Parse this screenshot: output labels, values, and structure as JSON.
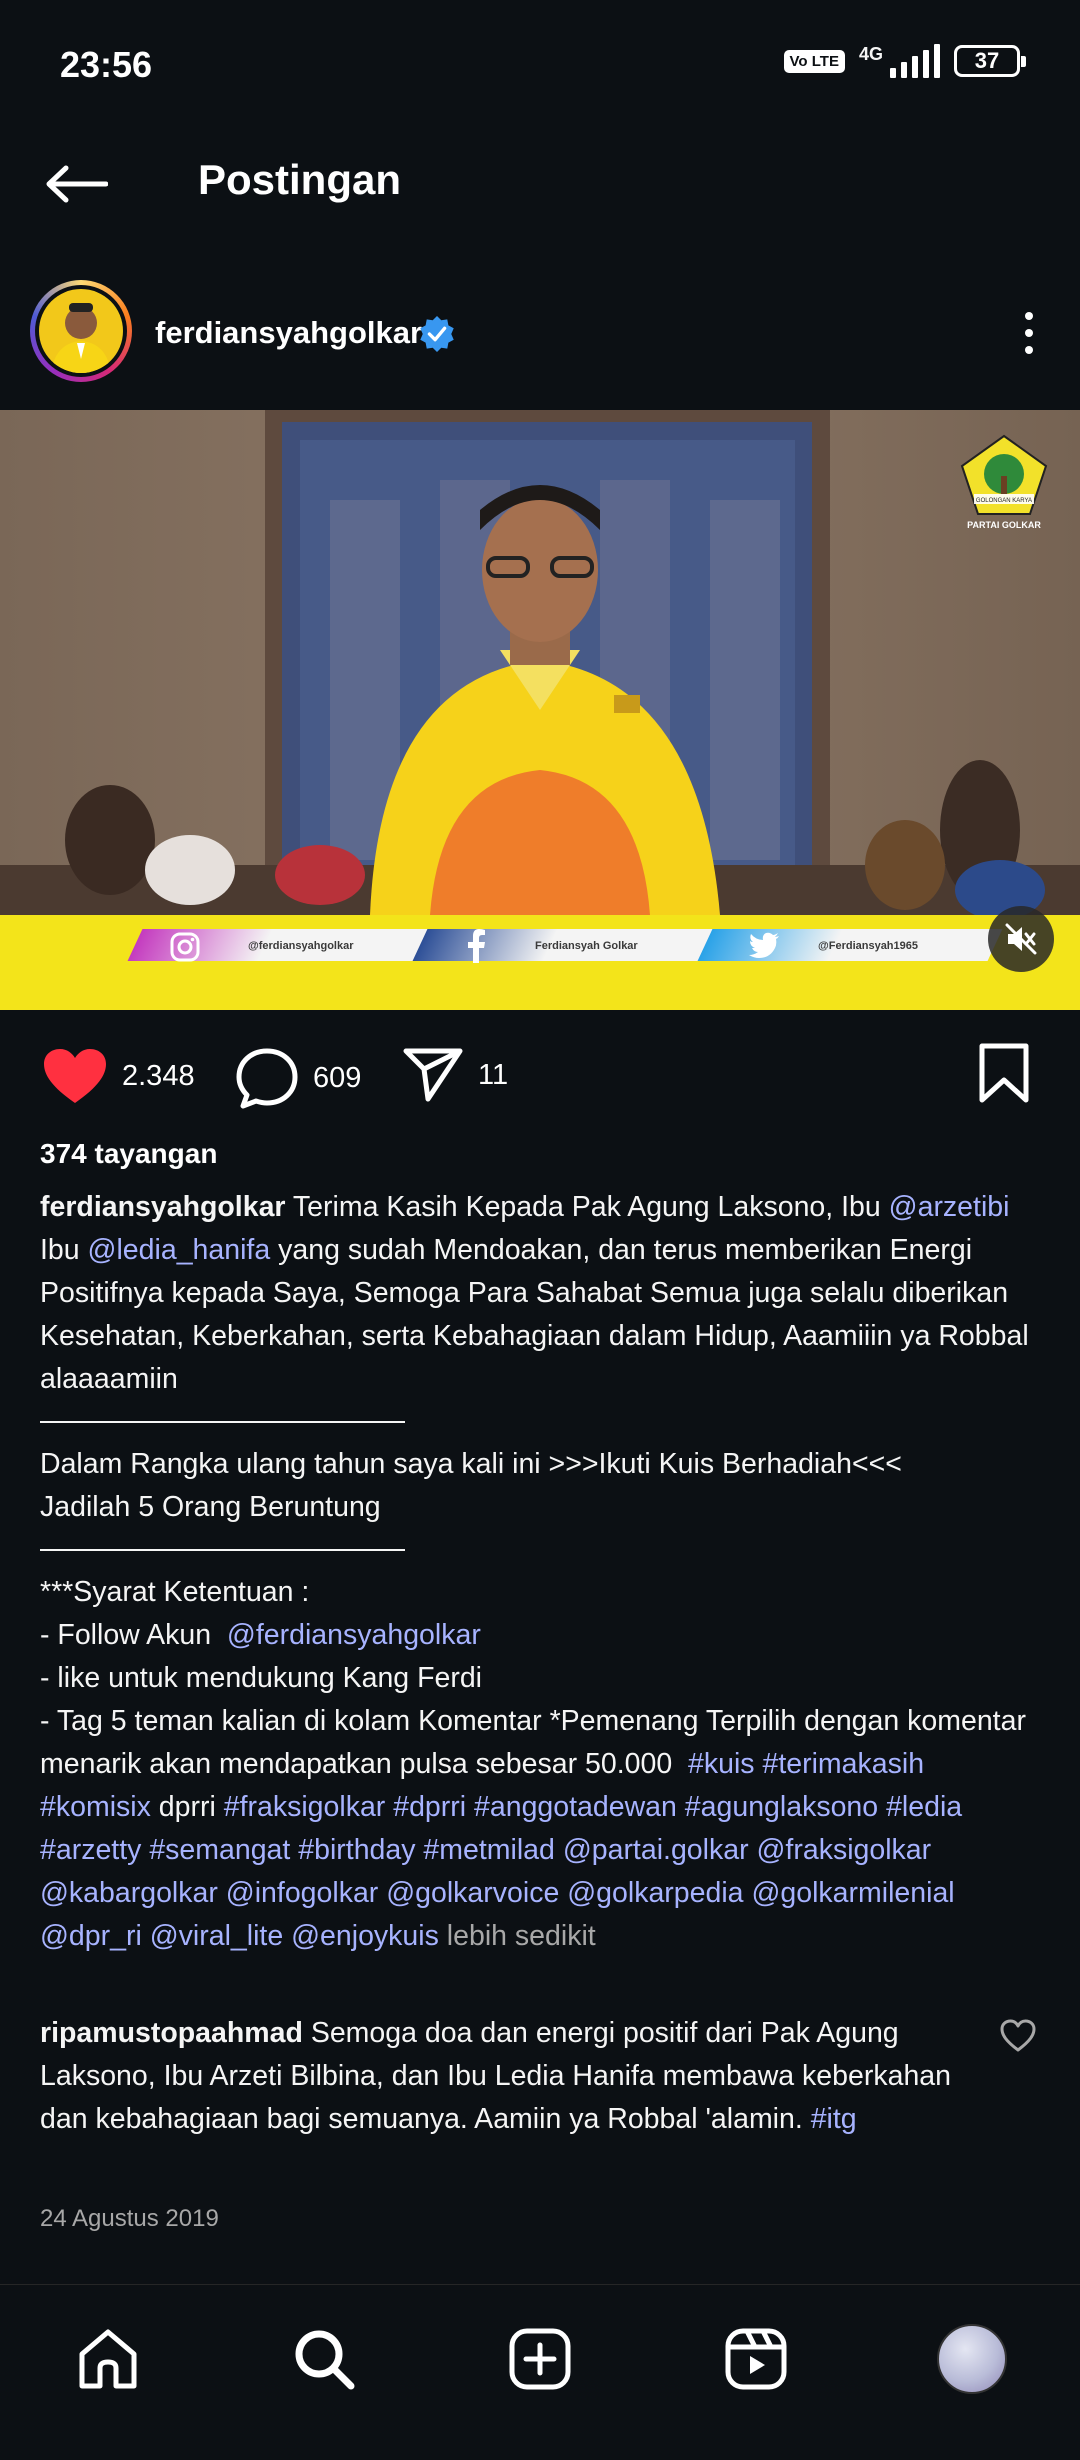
{
  "status_bar": {
    "time": "23:56",
    "volte": "Vo LTE",
    "network": "4G",
    "battery": "37"
  },
  "header": {
    "title": "Postingan"
  },
  "post": {
    "username": "ferdiansyahgolkar",
    "media": {
      "logo_text_top": "GOLONGAN KARYA",
      "logo_text_bottom": "PARTAI GOLKAR",
      "banner_instagram": "@ferdiansyahgolkar",
      "banner_facebook": "Ferdiansyah Golkar",
      "banner_twitter": "@Ferdiansyah1965"
    },
    "likes": "2.348",
    "comments": "609",
    "shares": "11",
    "views": "374 tayangan",
    "caption": {
      "author": "ferdiansyahgolkar",
      "p1_a": "Terima Kasih Kepada Pak Agung Laksono, Ibu",
      "m_arzetibi": "@arzetibi",
      "p1_b": "Ibu",
      "m_ledia": "@ledia_hanifa",
      "p1_c": "yang sudah Mendoakan, dan terus memberikan Energi Positifnya kepada Saya, Semoga Para Sahabat Semua juga selalu diberikan Kesehatan, Keberkahan, serta Kebahagiaan dalam Hidup, Aaamiiin ya Robbal alaaaamiin",
      "p2_line1": "Dalam Rangka ulang tahun saya kali ini >>>Ikuti Kuis Berhadiah<<<",
      "p2_line2": "Jadilah 5 Orang Beruntung",
      "p3_line1": "***Syarat Ketentuan :",
      "p3_follow": "- Follow Akun",
      "m_self": "@ferdiansyahgolkar",
      "p3_like": "- like untuk mendukung Kang Ferdi",
      "p3_tag": "- Tag 5 teman kalian di  kolam Komentar *Pemenang Terpilih dengan komentar menarik akan mendapatkan pulsa sebesar 50.000",
      "h_kuis": "#kuis",
      "h_terimakasih": "#terimakasih",
      "h_komisix": "#komisix",
      "w_dprri": "dprri",
      "h_fraksigolkar": "#fraksigolkar",
      "h_dprri": "#dprri",
      "h_anggotadewan": "#anggotadewan",
      "h_agunglaksono": "#agunglaksono",
      "h_ledia": "#ledia",
      "h_arzetty": "#arzetty",
      "h_semangat": "#semangat",
      "h_birthday": "#birthday",
      "h_metmilad": "#metmilad",
      "m_partaigolkar": "@partai.golkar",
      "m_fraksigolkar": "@fraksigolkar",
      "m_kabargolkar": "@kabargolkar",
      "m_infogolkar": "@infogolkar",
      "m_golkarvoice": "@golkarvoice",
      "m_golkarpedia": "@golkarpedia",
      "m_golkarmilenial": "@golkarmilenial",
      "m_dpr_ri": "@dpr_ri",
      "m_viral_lite": "@viral_lite",
      "m_enjoykuis": "@enjoykuis",
      "less": "lebih sedikit"
    },
    "comment": {
      "author": "ripamustopaahmad",
      "text": "Semoga doa dan energi positif dari Pak Agung Laksono, Ibu Arzeti Bilbina, dan Ibu Ledia Hanifa membawa keberkahan dan kebahagiaan bagi semuanya. Aamiin ya Robbal 'alamin.",
      "hashtag": "#itg"
    },
    "date": "24 Agustus 2019"
  },
  "colors": {
    "background": "#0c1014",
    "link": "#a7b3ff",
    "like": "#ff3040",
    "verified": "#3897f0",
    "banner": "#f3e41a"
  },
  "icons": {
    "back": "arrow-left-icon",
    "verified": "verified-badge-icon",
    "more": "more-vertical-icon",
    "like": "heart-filled-icon",
    "comment": "comment-bubble-icon",
    "share": "paper-plane-icon",
    "save": "bookmark-icon",
    "mute": "speaker-muted-icon",
    "nav": [
      "home-icon",
      "search-icon",
      "add-post-icon",
      "reels-icon",
      "profile-avatar"
    ]
  }
}
